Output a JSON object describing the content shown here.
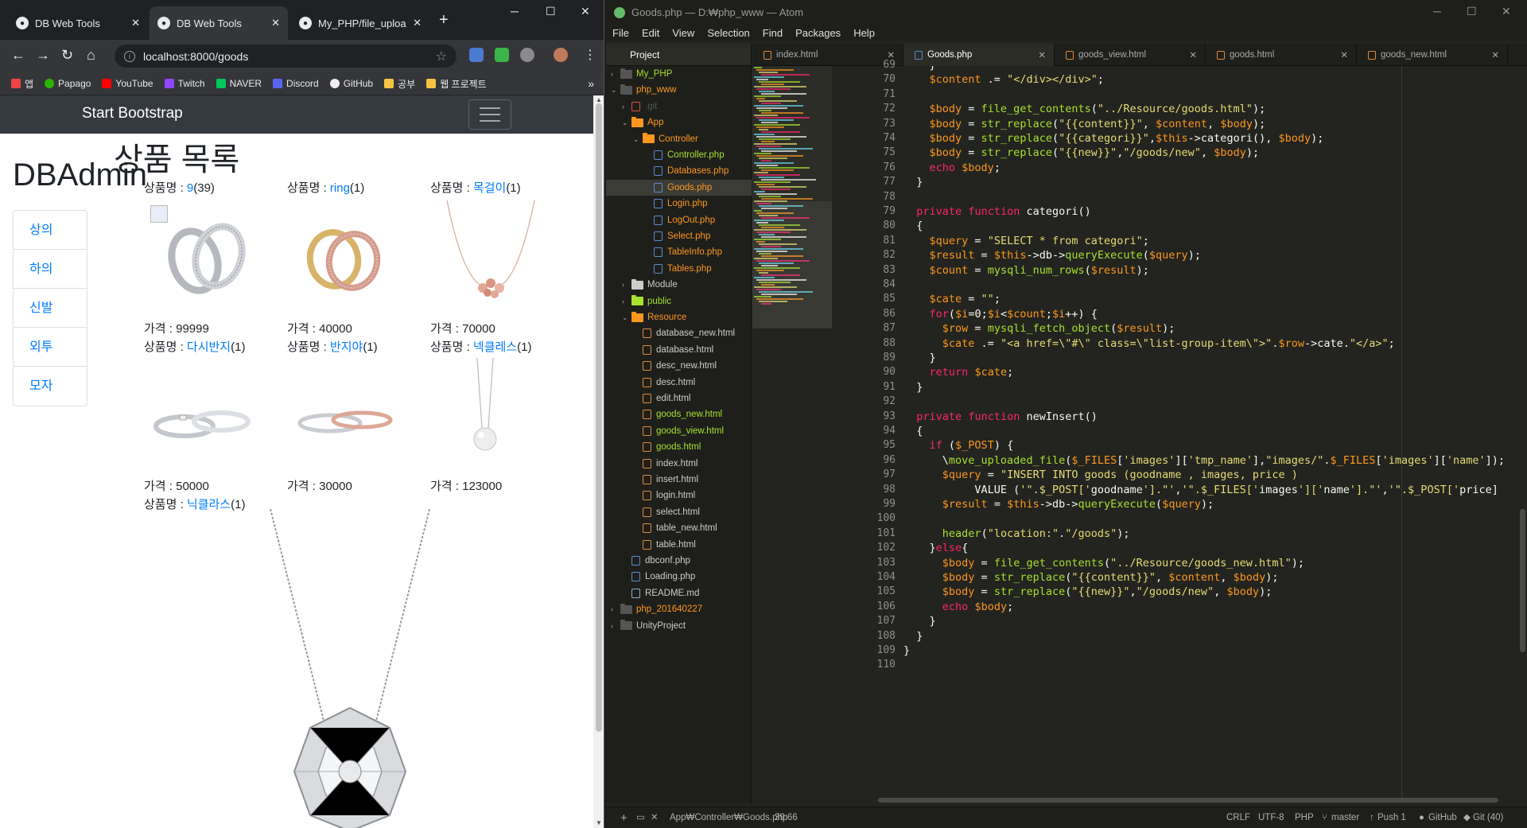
{
  "chrome": {
    "tabs": [
      {
        "title": "DB Web Tools",
        "active": false
      },
      {
        "title": "DB Web Tools",
        "active": true
      },
      {
        "title": "My_PHP/file_upload",
        "active": false
      }
    ],
    "url": "localhost:8000/goods",
    "bookmarks": [
      "앱",
      "Papago",
      "YouTube",
      "Twitch",
      "NAVER",
      "Discord",
      "GitHub",
      "공부",
      "웹 프로젝트"
    ],
    "bookmarks_more": "»"
  },
  "site": {
    "brand": "Start Bootstrap",
    "page_title": "상품 목록",
    "side_title": "DBAdmin",
    "categories": [
      "상의",
      "하의",
      "신발",
      "외투",
      "모자"
    ],
    "name_label": "상품명 : ",
    "price_label": "가격 : ",
    "goods": [
      {
        "name": "9",
        "count": "(39)",
        "price": "99999",
        "img": "ring-pair-silver",
        "broken": true
      },
      {
        "name": "ring",
        "count": "(1)",
        "price": "40000",
        "img": "ring-pair-gold"
      },
      {
        "name": "목걸이",
        "count": "(1)",
        "price": "70000",
        "img": "necklace-rose"
      },
      {
        "name": "다시반지",
        "count": "(1)",
        "price": "50000",
        "img": "ring-pair-flat"
      },
      {
        "name": "반지야",
        "count": "(1)",
        "price": "30000",
        "img": "ring-pair-twist"
      },
      {
        "name": "넥클레스",
        "count": "(1)",
        "price": "123000",
        "img": "necklace-pearl"
      },
      {
        "name": "닉클라스",
        "count": "(1)",
        "price": "",
        "img": "necklace-large"
      }
    ]
  },
  "atom": {
    "title": "Goods.php — D:₩php_www — Atom",
    "menu": [
      "File",
      "Edit",
      "View",
      "Selection",
      "Find",
      "Packages",
      "Help"
    ],
    "tree_header": "Project",
    "tree": [
      {
        "label": "My_PHP",
        "kind": "repo",
        "color": "#a6e22e",
        "depth": 0,
        "arrow": "›"
      },
      {
        "label": "php_www",
        "kind": "repo",
        "color": "#fd971f",
        "depth": 0,
        "arrow": "⌄"
      },
      {
        "label": ".git",
        "kind": "git",
        "color": "#555",
        "depth": 1,
        "arrow": "›"
      },
      {
        "label": "App",
        "kind": "folder",
        "color": "#fd971f",
        "depth": 1,
        "arrow": "⌄"
      },
      {
        "label": "Controller",
        "kind": "folder",
        "color": "#fd971f",
        "depth": 2,
        "arrow": "⌄"
      },
      {
        "label": "Controller.php",
        "kind": "php",
        "color": "#a6e22e",
        "depth": 3
      },
      {
        "label": "Databases.php",
        "kind": "php",
        "color": "#fd971f",
        "depth": 3
      },
      {
        "label": "Goods.php",
        "kind": "php",
        "color": "#fd971f",
        "depth": 3,
        "selected": true
      },
      {
        "label": "Login.php",
        "kind": "php",
        "color": "#fd971f",
        "depth": 3
      },
      {
        "label": "LogOut.php",
        "kind": "php",
        "color": "#fd971f",
        "depth": 3
      },
      {
        "label": "Select.php",
        "kind": "php",
        "color": "#fd971f",
        "depth": 3
      },
      {
        "label": "TableInfo.php",
        "kind": "php",
        "color": "#fd971f",
        "depth": 3
      },
      {
        "label": "Tables.php",
        "kind": "php",
        "color": "#fd971f",
        "depth": 3
      },
      {
        "label": "Module",
        "kind": "folder",
        "color": "#ccc",
        "depth": 1,
        "arrow": "›"
      },
      {
        "label": "public",
        "kind": "folder",
        "color": "#a6e22e",
        "depth": 1,
        "arrow": "›"
      },
      {
        "label": "Resource",
        "kind": "folder",
        "color": "#fd971f",
        "depth": 1,
        "arrow": "⌄"
      },
      {
        "label": "database_new.html",
        "kind": "html",
        "color": "#ccc",
        "depth": 2
      },
      {
        "label": "database.html",
        "kind": "html",
        "color": "#ccc",
        "depth": 2
      },
      {
        "label": "desc_new.html",
        "kind": "html",
        "color": "#ccc",
        "depth": 2
      },
      {
        "label": "desc.html",
        "kind": "html",
        "color": "#ccc",
        "depth": 2
      },
      {
        "label": "edit.html",
        "kind": "html",
        "color": "#ccc",
        "depth": 2
      },
      {
        "label": "goods_new.html",
        "kind": "html",
        "color": "#a6e22e",
        "depth": 2
      },
      {
        "label": "goods_view.html",
        "kind": "html",
        "color": "#a6e22e",
        "depth": 2
      },
      {
        "label": "goods.html",
        "kind": "html",
        "color": "#a6e22e",
        "depth": 2
      },
      {
        "label": "index.html",
        "kind": "html",
        "color": "#ccc",
        "depth": 2
      },
      {
        "label": "insert.html",
        "kind": "html",
        "color": "#ccc",
        "depth": 2
      },
      {
        "label": "login.html",
        "kind": "html",
        "color": "#ccc",
        "depth": 2
      },
      {
        "label": "select.html",
        "kind": "html",
        "color": "#ccc",
        "depth": 2
      },
      {
        "label": "table_new.html",
        "kind": "html",
        "color": "#ccc",
        "depth": 2
      },
      {
        "label": "table.html",
        "kind": "html",
        "color": "#ccc",
        "depth": 2
      },
      {
        "label": "dbconf.php",
        "kind": "php",
        "color": "#ccc",
        "depth": 1
      },
      {
        "label": "Loading.php",
        "kind": "php",
        "color": "#ccc",
        "depth": 1
      },
      {
        "label": "README.md",
        "kind": "md",
        "color": "#ccc",
        "depth": 1
      },
      {
        "label": "php_201640227",
        "kind": "repo",
        "color": "#fd971f",
        "depth": 0,
        "arrow": "›"
      },
      {
        "label": "UnityProject",
        "kind": "repo",
        "color": "#ccc",
        "depth": 0,
        "arrow": "›"
      }
    ],
    "editor_tabs": [
      {
        "label": "index.html",
        "active": false
      },
      {
        "label": "Goods.php",
        "active": true
      },
      {
        "label": "goods_view.html",
        "active": false
      },
      {
        "label": "goods.html",
        "active": false
      },
      {
        "label": "goods_new.html",
        "active": false
      }
    ],
    "first_line": 69,
    "code": [
      "    }",
      "    $content .= \"</div></div>\";",
      "",
      "    $body = file_get_contents(\"../Resource/goods.html\");",
      "    $body = str_replace(\"{{content}}\", $content, $body);",
      "    $body = str_replace(\"{{categori}}\",$this->categori(), $body);",
      "    $body = str_replace(\"{{new}}\",\"/goods/new\", $body);",
      "    echo $body;",
      "  }",
      "",
      "  private function categori()",
      "  {",
      "    $query = \"SELECT * from categori\";",
      "    $result = $this->db->queryExecute($query);",
      "    $count = mysqli_num_rows($result);",
      "",
      "    $cate = \"\";",
      "    for($i=0;$i<$count;$i++) {",
      "      $row = mysqli_fetch_object($result);",
      "      $cate .= \"<a href=\\\"#\\\" class=\\\"list-group-item\\\">\".$row->cate.\"</a>\";",
      "    }",
      "    return $cate;",
      "  }",
      "",
      "  private function newInsert()",
      "  {",
      "    if ($_POST) {",
      "      \\move_uploaded_file($_FILES['images']['tmp_name'],\"images/\".$_FILES['images']['name']);",
      "      $query = \"INSERT INTO goods (goodname , images, price )",
      "           VALUE ('\".$_POST['goodname'].\"','\".$_FILES['images']['name'].\"','\".$_POST['price']",
      "      $result = $this->db->queryExecute($query);",
      "",
      "      header(\"location:\".\"/goods\");",
      "    }else{",
      "      $body = file_get_contents(\"../Resource/goods_new.html\");",
      "      $body = str_replace(\"{{content}}\", $content, $body);",
      "      $body = str_replace(\"{{new}}\",\"/goods/new\", $body);",
      "      echo $body;",
      "    }",
      "  }",
      "}",
      ""
    ],
    "status": {
      "add": "+",
      "path": "App₩Controller₩Goods.php",
      "cursor": "39:66",
      "eol": "CRLF",
      "encoding": "UTF-8",
      "grammar": "PHP",
      "branch": "master",
      "push": "Push 1",
      "github": "GitHub",
      "git": "Git (40)"
    }
  }
}
